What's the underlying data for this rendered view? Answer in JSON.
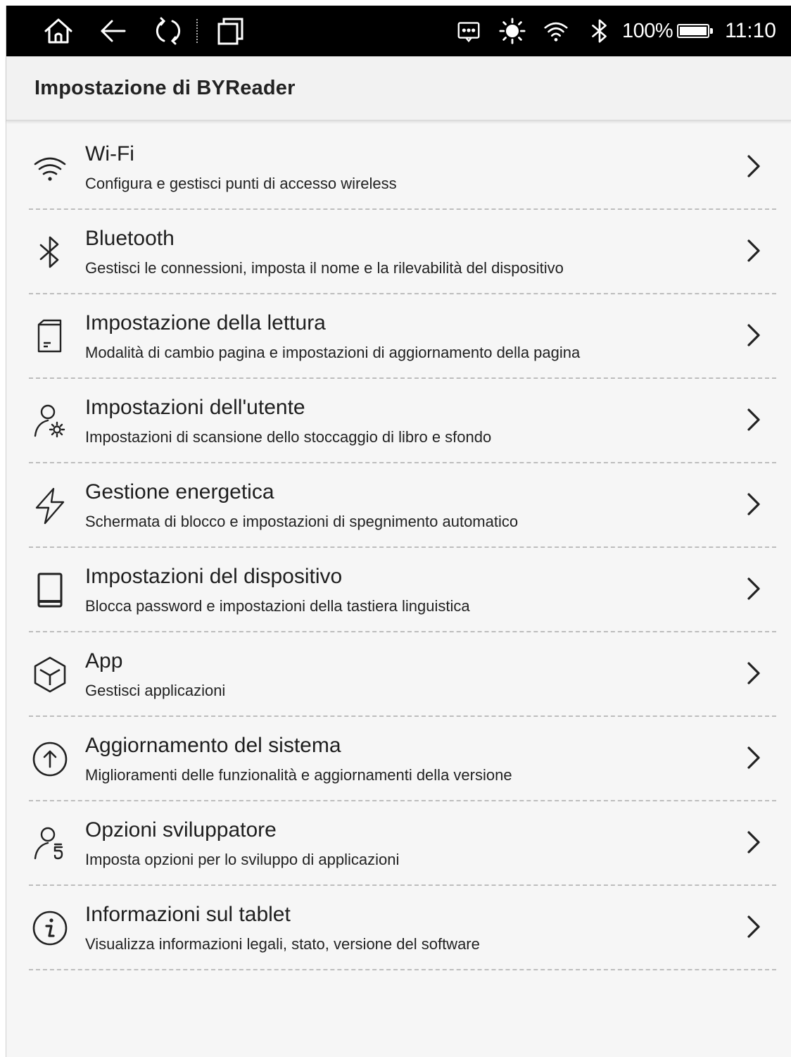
{
  "status_bar": {
    "battery_percent": "100%",
    "battery_level": 1.0,
    "time": "11:10",
    "icons": [
      "home-icon",
      "back-icon",
      "refresh-icon",
      "multiwindow-icon",
      "message-icon",
      "brightness-icon",
      "wifi-icon",
      "bluetooth-icon",
      "battery-icon"
    ]
  },
  "header": {
    "title": "Impostazione di BYReader"
  },
  "settings": [
    {
      "icon": "wifi-icon",
      "title": "Wi-Fi",
      "subtitle": "Configura e gestisci punti di accesso wireless"
    },
    {
      "icon": "bluetooth-icon",
      "title": "Bluetooth",
      "subtitle": "Gestisci le connessioni, imposta il nome e la rilevabilità del dispositivo"
    },
    {
      "icon": "reading-icon",
      "title": "Impostazione della lettura",
      "subtitle": "Modalità di cambio pagina e impostazioni di aggiornamento della pagina"
    },
    {
      "icon": "user-settings-icon",
      "title": "Impostazioni dell'utente",
      "subtitle": "Impostazioni di scansione dello stoccaggio di libro e sfondo"
    },
    {
      "icon": "power-icon",
      "title": "Gestione energetica",
      "subtitle": "Schermata di blocco e impostazioni di spegnimento automatico"
    },
    {
      "icon": "device-icon",
      "title": "Impostazioni del dispositivo",
      "subtitle": "Blocca password e impostazioni della tastiera linguistica"
    },
    {
      "icon": "app-box-icon",
      "title": "App",
      "subtitle": "Gestisci applicazioni"
    },
    {
      "icon": "system-update-icon",
      "title": "Aggiornamento del sistema",
      "subtitle": "Miglioramenti delle funzionalità e aggiornamenti della versione"
    },
    {
      "icon": "developer-icon",
      "title": "Opzioni sviluppatore",
      "subtitle": "Imposta opzioni per lo sviluppo di applicazioni"
    },
    {
      "icon": "info-icon",
      "title": "Informazioni sul tablet",
      "subtitle": "Visualizza informazioni legali, stato, versione del software"
    }
  ]
}
